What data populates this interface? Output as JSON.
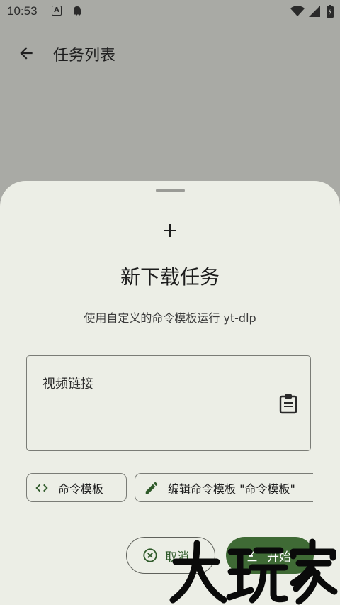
{
  "status_bar": {
    "time": "10:53",
    "icons": [
      "a-notification-icon",
      "ghost-notification-icon",
      "wifi-icon",
      "signal-icon",
      "battery-icon"
    ]
  },
  "app_bar": {
    "title": "任务列表",
    "back_icon": "arrow-back-icon"
  },
  "sheet": {
    "icon": "plus-icon",
    "title": "新下载任务",
    "subtitle": "使用自定义的命令模板运行 yt-dlp",
    "url_field": {
      "label": "视频链接",
      "trailing_icon": "clipboard-paste-icon"
    },
    "chips": [
      {
        "label": "命令模板",
        "icon": "code-icon"
      },
      {
        "label": "编辑命令模板 \"命令模板\"",
        "icon": "pencil-icon"
      }
    ],
    "buttons": {
      "cancel": "取消",
      "start": "开始"
    }
  },
  "watermark": {
    "text": "大玩家"
  },
  "colors": {
    "scrim": "#a9aaa5",
    "sheet_bg": "#eceee6",
    "primary": "#3f6a35",
    "outline": "#7a7c76"
  }
}
